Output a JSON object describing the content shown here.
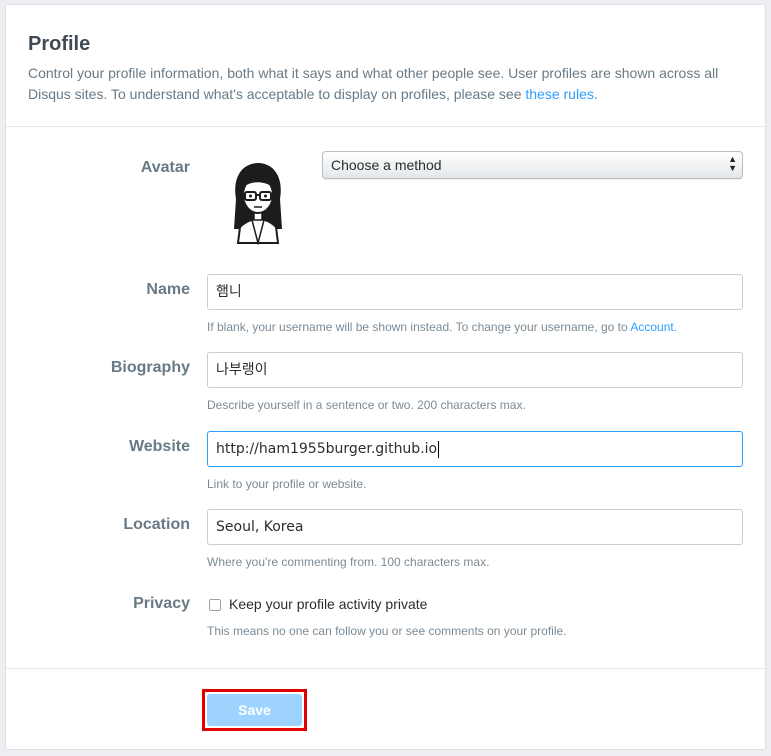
{
  "profile": {
    "title": "Profile",
    "description": "Control your profile information, both what it says and what other people see. User profiles are shown across all Disqus sites. To understand what's acceptable to display on profiles, please see ",
    "rules_link": "these rules",
    "description_end": "."
  },
  "avatar": {
    "label": "Avatar",
    "method_select": "Choose a method"
  },
  "name": {
    "label": "Name",
    "value": "햄니",
    "help": "If blank, your username will be shown instead. To change your username, go to ",
    "help_link": "Account",
    "help_end": "."
  },
  "biography": {
    "label": "Biography",
    "value": "나부랭이",
    "help": "Describe yourself in a sentence or two. 200 characters max."
  },
  "website": {
    "label": "Website",
    "value": "http://ham1955burger.github.io",
    "help": "Link to your profile or website."
  },
  "location": {
    "label": "Location",
    "value": "Seoul, Korea",
    "help": "Where you're commenting from. 100 characters max."
  },
  "privacy": {
    "label": "Privacy",
    "checkbox_label": "Keep your profile activity private",
    "checked": false,
    "help": "This means no one can follow you or see comments on your profile."
  },
  "actions": {
    "save_label": "Save"
  },
  "colors": {
    "link": "#2e9fff",
    "save_button": "#9fd3ff",
    "highlight_outline": "#e00000"
  }
}
